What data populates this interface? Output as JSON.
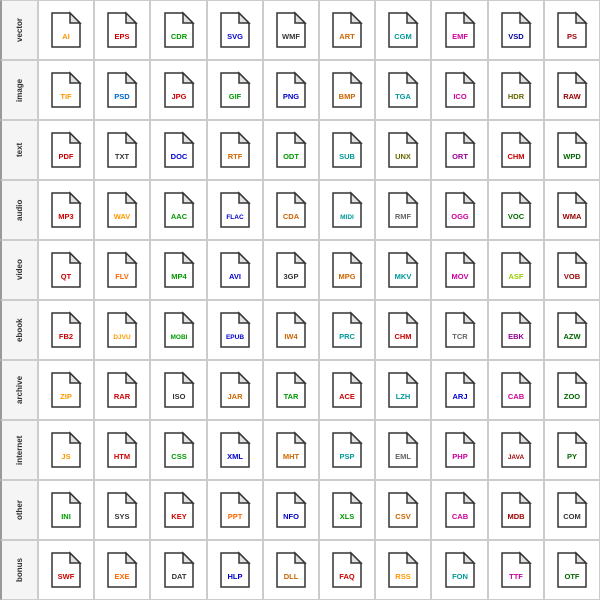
{
  "rows": [
    {
      "label": "vector",
      "files": [
        {
          "name": "AI",
          "color": "#ff9900"
        },
        {
          "name": "EPS",
          "color": "#cc0000"
        },
        {
          "name": "CDR",
          "color": "#009900"
        },
        {
          "name": "SVG",
          "color": "#0000cc"
        },
        {
          "name": "WMF",
          "color": "#333333"
        },
        {
          "name": "ART",
          "color": "#cc6600"
        },
        {
          "name": "CGM",
          "color": "#009999"
        },
        {
          "name": "EMF",
          "color": "#cc0099"
        },
        {
          "name": "VSD",
          "color": "#000099"
        },
        {
          "name": "PS",
          "color": "#990000"
        }
      ]
    },
    {
      "label": "image",
      "files": [
        {
          "name": "TIF",
          "color": "#ff9900"
        },
        {
          "name": "PSD",
          "color": "#0066cc"
        },
        {
          "name": "JPG",
          "color": "#cc0000"
        },
        {
          "name": "GIF",
          "color": "#009900"
        },
        {
          "name": "PNG",
          "color": "#0000cc"
        },
        {
          "name": "BMP",
          "color": "#cc6600"
        },
        {
          "name": "TGA",
          "color": "#009999"
        },
        {
          "name": "ICO",
          "color": "#cc0099"
        },
        {
          "name": "HDR",
          "color": "#666600"
        },
        {
          "name": "RAW",
          "color": "#990000"
        }
      ]
    },
    {
      "label": "text",
      "files": [
        {
          "name": "PDF",
          "color": "#cc0000"
        },
        {
          "name": "TXT",
          "color": "#333333"
        },
        {
          "name": "DOC",
          "color": "#0000cc"
        },
        {
          "name": "RTF",
          "color": "#cc6600"
        },
        {
          "name": "ODT",
          "color": "#009900"
        },
        {
          "name": "SUB",
          "color": "#009999"
        },
        {
          "name": "UNX",
          "color": "#666600"
        },
        {
          "name": "ORT",
          "color": "#990099"
        },
        {
          "name": "CHM",
          "color": "#cc0000"
        },
        {
          "name": "WPD",
          "color": "#006600"
        }
      ]
    },
    {
      "label": "audio",
      "files": [
        {
          "name": "MP3",
          "color": "#cc0000"
        },
        {
          "name": "WAV",
          "color": "#ff9900"
        },
        {
          "name": "AAC",
          "color": "#009900"
        },
        {
          "name": "FLAC",
          "color": "#0000cc"
        },
        {
          "name": "CDA",
          "color": "#cc6600"
        },
        {
          "name": "MIDI",
          "color": "#009999"
        },
        {
          "name": "RMF",
          "color": "#666666"
        },
        {
          "name": "OGG",
          "color": "#cc0099"
        },
        {
          "name": "VOC",
          "color": "#006600"
        },
        {
          "name": "WMA",
          "color": "#990000"
        }
      ]
    },
    {
      "label": "video",
      "files": [
        {
          "name": "QT",
          "color": "#cc0000"
        },
        {
          "name": "FLV",
          "color": "#ff6600"
        },
        {
          "name": "MP4",
          "color": "#009900"
        },
        {
          "name": "AVI",
          "color": "#0000cc"
        },
        {
          "name": "3GP",
          "color": "#333333"
        },
        {
          "name": "MPG",
          "color": "#cc6600"
        },
        {
          "name": "MKV",
          "color": "#009999"
        },
        {
          "name": "MOV",
          "color": "#cc0099"
        },
        {
          "name": "ASF",
          "color": "#99cc00"
        },
        {
          "name": "VOB",
          "color": "#990000"
        }
      ]
    },
    {
      "label": "ebook",
      "files": [
        {
          "name": "FB2",
          "color": "#cc0000"
        },
        {
          "name": "DJVU",
          "color": "#ff9900"
        },
        {
          "name": "MOBI",
          "color": "#009900"
        },
        {
          "name": "EPUB",
          "color": "#0000cc"
        },
        {
          "name": "IW4",
          "color": "#cc6600"
        },
        {
          "name": "PRC",
          "color": "#009999"
        },
        {
          "name": "CHM",
          "color": "#cc0000"
        },
        {
          "name": "TCR",
          "color": "#666666"
        },
        {
          "name": "EBK",
          "color": "#990099"
        },
        {
          "name": "AZW",
          "color": "#006600"
        }
      ]
    },
    {
      "label": "archive",
      "files": [
        {
          "name": "ZIP",
          "color": "#ff9900"
        },
        {
          "name": "RAR",
          "color": "#cc0000"
        },
        {
          "name": "ISO",
          "color": "#333333"
        },
        {
          "name": "JAR",
          "color": "#cc6600"
        },
        {
          "name": "TAR",
          "color": "#009900"
        },
        {
          "name": "ACE",
          "color": "#cc0000"
        },
        {
          "name": "LZH",
          "color": "#009999"
        },
        {
          "name": "ARJ",
          "color": "#0000cc"
        },
        {
          "name": "CAB",
          "color": "#cc0099"
        },
        {
          "name": "ZOO",
          "color": "#006600"
        }
      ]
    },
    {
      "label": "internet",
      "files": [
        {
          "name": "JS",
          "color": "#ff9900"
        },
        {
          "name": "HTM",
          "color": "#cc0000"
        },
        {
          "name": "CSS",
          "color": "#009900"
        },
        {
          "name": "XML",
          "color": "#0000cc"
        },
        {
          "name": "MHT",
          "color": "#cc6600"
        },
        {
          "name": "PSP",
          "color": "#009999"
        },
        {
          "name": "EML",
          "color": "#666666"
        },
        {
          "name": "PHP",
          "color": "#cc0099"
        },
        {
          "name": "JAVA",
          "color": "#990000"
        },
        {
          "name": "PY",
          "color": "#006600"
        }
      ]
    },
    {
      "label": "other",
      "files": [
        {
          "name": "INI",
          "color": "#009900"
        },
        {
          "name": "SYS",
          "color": "#333333"
        },
        {
          "name": "KEY",
          "color": "#cc0000"
        },
        {
          "name": "PPT",
          "color": "#ff6600"
        },
        {
          "name": "NFO",
          "color": "#0000cc"
        },
        {
          "name": "XLS",
          "color": "#009900"
        },
        {
          "name": "CSV",
          "color": "#cc6600"
        },
        {
          "name": "CAB",
          "color": "#cc0099"
        },
        {
          "name": "MDB",
          "color": "#990000"
        },
        {
          "name": "COM",
          "color": "#333333"
        }
      ]
    },
    {
      "label": "bonus",
      "files": [
        {
          "name": "SWF",
          "color": "#cc0000"
        },
        {
          "name": "EXE",
          "color": "#ff6600"
        },
        {
          "name": "DAT",
          "color": "#333333"
        },
        {
          "name": "HLP",
          "color": "#0000cc"
        },
        {
          "name": "DLL",
          "color": "#cc6600"
        },
        {
          "name": "FAQ",
          "color": "#cc0000"
        },
        {
          "name": "RSS",
          "color": "#ff9900"
        },
        {
          "name": "FON",
          "color": "#009999"
        },
        {
          "name": "TTF",
          "color": "#cc0099"
        },
        {
          "name": "OTF",
          "color": "#006600"
        }
      ]
    }
  ]
}
